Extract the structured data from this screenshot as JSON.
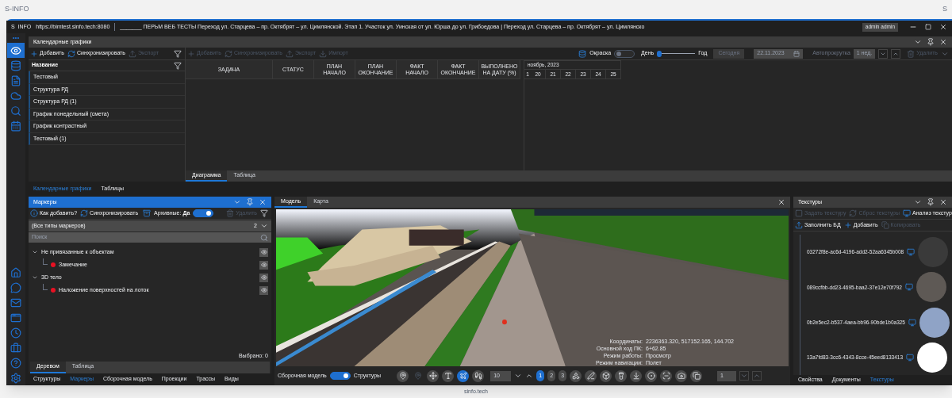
{
  "page": {
    "title": "S-INFO",
    "corner": "S",
    "footer": "sinfo.tech"
  },
  "window": {
    "app": "S  INFO",
    "url": "https://bimtest.sinfo.tech:8080",
    "title": "_______ ПЕРЬМ ВЕБ ТЕСТЫ Переход ул. Старцева – пр. Октябрят – ул. Цимлянской. Этап 1. Участок ул. Уинская от ул. Юрша до ул. Грибоедова | Переход ул. Старцева – пр. Октябрят – ул. Цимлянско",
    "user": "admin admin"
  },
  "sidebar": {
    "more": "•••",
    "top": [
      {
        "selected": true
      },
      {
        "selected": false
      },
      {
        "selected": false
      },
      {
        "selected": false
      },
      {
        "selected": false
      },
      {
        "selected": false
      }
    ],
    "bottom": [
      {
        "selected": false
      },
      {
        "selected": false
      },
      {
        "selected": false
      },
      {
        "selected": false
      },
      {
        "selected": false
      },
      {
        "selected": false
      },
      {
        "selected": false
      },
      {
        "selected": false
      }
    ]
  },
  "schedule": {
    "title": "Календарные графики",
    "left_toolbar": [
      {
        "label": "Добавить",
        "disabled": false
      },
      {
        "label": "Синхронизировать",
        "disabled": false
      },
      {
        "label": "Экспорт",
        "disabled": true
      }
    ],
    "list_header": "Название",
    "items": [
      "Тестовый",
      "Структура РД",
      "Структура РД (1)",
      "График понедельный (смета)",
      "График контрастный",
      "Тестовый (1)"
    ],
    "right_toolbar": [
      {
        "label": "Добавить",
        "disabled": true
      },
      {
        "label": "Синхронизировать",
        "disabled": true
      },
      {
        "label": "Экспорт",
        "disabled": true
      },
      {
        "label": "Импорт",
        "disabled": true
      }
    ],
    "coloring": {
      "label": "Окраска",
      "on": false
    },
    "scale": {
      "min_label": "День",
      "max_label": "Год",
      "level": 0.05
    },
    "today": {
      "label": "Сегодня",
      "disabled": true
    },
    "date": "22.11.2023",
    "autoscroll": {
      "label": "Автопрокрутка",
      "disabled": true
    },
    "step": "1 нед.",
    "delete": {
      "label": "Удалить",
      "disabled": true
    },
    "columns": [
      "ЗАДАЧА",
      "СТАТУС",
      "ПЛАН НАЧАЛО",
      "ПЛАН ОКОНЧАНИЕ",
      "ФАКТ НАЧАЛО",
      "ФАКТ ОКОНЧАНИЕ",
      "ВЫПОЛНЕНО НА ДАТУ (%)"
    ],
    "gantt": {
      "month": "ноябрь, 2023",
      "days": [
        "1",
        "20",
        "21",
        "22",
        "23",
        "24",
        "25"
      ]
    },
    "view_tabs": [
      {
        "label": "Диаграмма",
        "selected": true
      },
      {
        "label": "Таблица",
        "selected": false
      }
    ]
  },
  "doc_tabs": [
    {
      "label": "Календарные графики",
      "selected": true
    },
    {
      "label": "Таблицы",
      "selected": false
    }
  ],
  "markers": {
    "title": "Маркеры",
    "toolbar": [
      {
        "label": "Как добавить?",
        "disabled": false
      },
      {
        "label": "Синхронизировать",
        "disabled": false
      }
    ],
    "archive": {
      "label": "Архивные:",
      "value": "Да",
      "on": true
    },
    "delete": {
      "label": "Удалить",
      "disabled": true
    },
    "filter": {
      "value": "(Все типы маркеров)",
      "count": "2"
    },
    "search": {
      "placeholder": "Поиск"
    },
    "tree": [
      {
        "label": "Не привязанные к объектам",
        "expanded": true,
        "children": [
          {
            "label": "Замечание",
            "color": "#e81123"
          }
        ]
      },
      {
        "label": "3D тело",
        "expanded": true,
        "children": [
          {
            "label": "Наложение поверхностей на лоток",
            "color": "#e81123"
          }
        ]
      }
    ],
    "selected_count": "Выбрано: 0",
    "view_tabs": [
      {
        "label": "Деревом",
        "selected": true
      },
      {
        "label": "Таблица",
        "selected": false
      }
    ],
    "bottom_tabs": [
      {
        "label": "Структуры",
        "selected": false
      },
      {
        "label": "Маркеры",
        "selected": true
      },
      {
        "label": "Сборочная модель",
        "selected": false
      },
      {
        "label": "Проекции",
        "selected": false
      },
      {
        "label": "Трассы",
        "selected": false
      },
      {
        "label": "Виды",
        "selected": false
      }
    ]
  },
  "viewer": {
    "tabs": [
      {
        "label": "Модель",
        "selected": true
      },
      {
        "label": "Карта",
        "selected": false
      }
    ],
    "info": [
      {
        "label": "Координаты:",
        "value": "2236363.320, 517152.165, 144.702"
      },
      {
        "label": "Основной ход ПК:",
        "value": "6+62.85"
      },
      {
        "label": "Режим работы:",
        "value": "Просмотр"
      },
      {
        "label": "Режим навигации:",
        "value": "Полет"
      }
    ],
    "assembly": {
      "left": "Сборочная модель",
      "right": "Структуры",
      "on": true
    },
    "nav_modes": [
      {
        "selected": false
      },
      {
        "selected": false
      },
      {
        "selected": true
      },
      {
        "selected": false
      }
    ],
    "speed": "10",
    "levels": [
      {
        "label": "1",
        "selected": true
      },
      {
        "label": "2",
        "selected": false
      },
      {
        "label": "3",
        "selected": false
      }
    ],
    "page_value": "1"
  },
  "textures": {
    "title": "Текстуры",
    "toolbar1": [
      {
        "label": "Задать текстуру",
        "disabled": true
      },
      {
        "label": "Сброс текстуры",
        "disabled": true
      },
      {
        "label": "Анализ текстур",
        "disabled": false
      }
    ],
    "toolbar2": [
      {
        "label": "Заполнить БД",
        "disabled": false
      },
      {
        "label": "Добавить",
        "disabled": false
      },
      {
        "label": "Копировать",
        "disabled": true
      }
    ],
    "items": [
      {
        "id": "03272f8e-ac6d-4196-add2-52aa6345b008",
        "color": "#3a3a3a"
      },
      {
        "id": "089ccfbb-dd23-4695-baa2-37e12e70f792",
        "color": "#5e5955"
      },
      {
        "id": "0b2e5ec2-b537-4aea-bb96-90bde1b0a325",
        "color": "#8fa3c6"
      },
      {
        "id": "13a7fd83-3cc6-4343-8cce-45eed8133413",
        "color": "#ffffff"
      }
    ],
    "bottom_tabs": [
      {
        "label": "Свойства",
        "selected": false
      },
      {
        "label": "Документы",
        "selected": false
      },
      {
        "label": "Текстуры",
        "selected": true
      }
    ]
  }
}
